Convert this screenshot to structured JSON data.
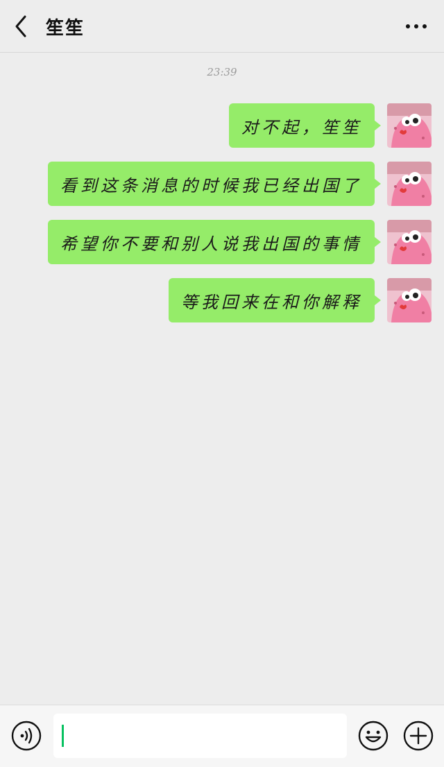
{
  "header": {
    "title": "笙笙",
    "back_icon": "chevron-left-icon",
    "more_icon": "more-horizontal-icon"
  },
  "chat": {
    "timestamp": "23:39",
    "messages": [
      {
        "sender": "self",
        "text": "对不起，笙笙"
      },
      {
        "sender": "self",
        "text": "看到这条消息的时候我已经出国了"
      },
      {
        "sender": "self",
        "text": "希望你不要和别人说我出国的事情"
      },
      {
        "sender": "self",
        "text": "等我回来在和你解释"
      }
    ],
    "bubble_color": "#95ec69"
  },
  "input_bar": {
    "input_value": "",
    "voice_icon": "voice-icon",
    "emoji_icon": "emoji-smile-icon",
    "plus_icon": "plus-circle-icon",
    "caret_color": "#07c160"
  }
}
